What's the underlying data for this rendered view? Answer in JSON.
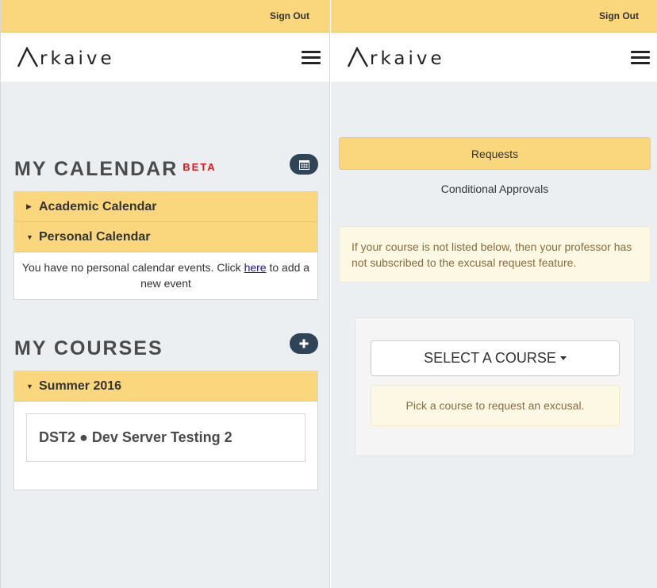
{
  "left": {
    "topbar": {
      "signout_label": "Sign Out"
    },
    "navbar": {
      "logo_text": "rkaive"
    },
    "calendar": {
      "title": "MY CALENDAR",
      "badge": "BETA",
      "button_icon": "calendar-icon",
      "academic": {
        "label": "Academic Calendar"
      },
      "personal": {
        "label": "Personal Calendar",
        "message_before": "You have no personal calendar events. Click ",
        "link": "here",
        "message_after": " to add a new event"
      }
    },
    "courses": {
      "title": "MY COURSES",
      "button_icon": "plus-icon",
      "term": {
        "label": "Summer 2016"
      },
      "items": [
        {
          "label": "DST2 ● Dev Server Testing 2"
        }
      ]
    }
  },
  "right": {
    "topbar": {
      "signout_label": "Sign Out"
    },
    "navbar": {
      "logo_text": "rkaive"
    },
    "requests_label": "Requests",
    "conditional_label": "Conditional Approvals",
    "notice": "If your course is not listed below, then your professor has not subscribed to the excusal request feature.",
    "select_course_label": "SELECT A COURSE",
    "pick_notice": "Pick a course to request an excusal."
  },
  "colors": {
    "accent": "#fad77c",
    "dark_button": "#2f4457",
    "beta_red": "#e0161c",
    "warning_text": "#8a6d3b"
  }
}
